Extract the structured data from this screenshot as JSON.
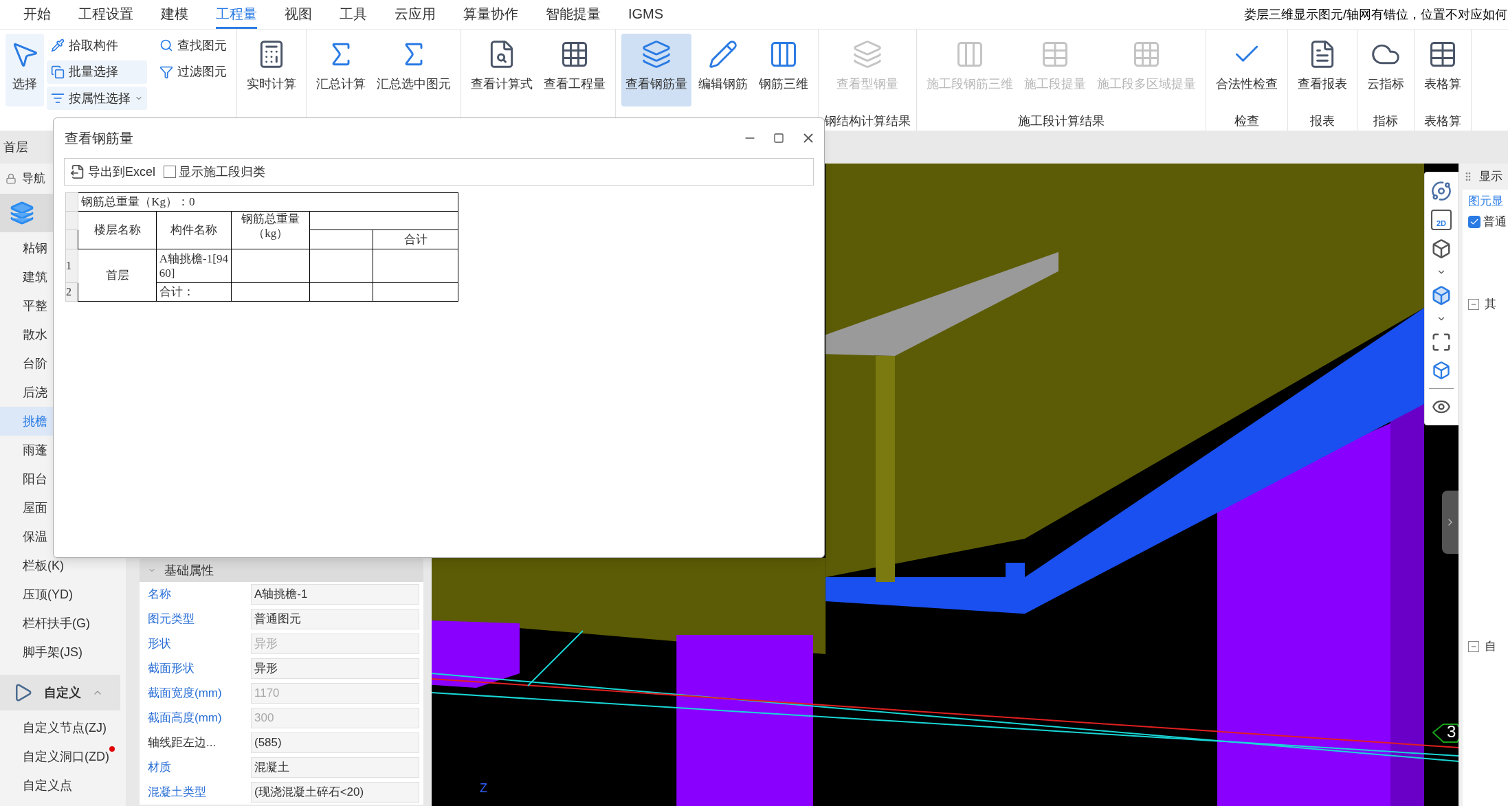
{
  "menu": [
    {
      "label": "开始",
      "selected": false
    },
    {
      "label": "工程设置",
      "selected": false
    },
    {
      "label": "建模",
      "selected": false
    },
    {
      "label": "工程量",
      "selected": true
    },
    {
      "label": "视图",
      "selected": false
    },
    {
      "label": "工具",
      "selected": false
    },
    {
      "label": "云应用",
      "selected": false
    },
    {
      "label": "算量协作",
      "selected": false
    },
    {
      "label": "智能提量",
      "selected": false
    },
    {
      "label": "IGMS",
      "selected": false
    }
  ],
  "help_search": "娄层三维显示图元/轴网有错位，位置不对应如何",
  "ribbon": [
    {
      "buttons": [
        {
          "label": "选择",
          "kind": "large",
          "selected": false,
          "highlighted": true,
          "disabled": false
        },
        {
          "label": "拾取构件",
          "kind": "small",
          "selected": false,
          "highlighted": false,
          "disabled": false
        },
        {
          "label": "批量选择",
          "kind": "small",
          "selected": false,
          "highlighted": true,
          "disabled": false
        },
        {
          "label": "按属性选择",
          "kind": "small",
          "selected": false,
          "highlighted": true,
          "disabled": false,
          "dropdown": true
        },
        {
          "label": "查找图元",
          "kind": "small",
          "selected": false,
          "highlighted": false,
          "disabled": false
        },
        {
          "label": "过滤图元",
          "kind": "small",
          "selected": false,
          "highlighted": false,
          "disabled": false
        }
      ]
    },
    {
      "buttons": [
        {
          "label": "实时计算",
          "kind": "large",
          "selected": false,
          "highlighted": false,
          "disabled": false
        }
      ]
    },
    {
      "buttons": [
        {
          "label": "汇总计算",
          "kind": "large",
          "selected": false,
          "highlighted": false,
          "disabled": false
        },
        {
          "label": "汇总选中图元",
          "kind": "large",
          "selected": false,
          "highlighted": false,
          "disabled": false
        }
      ]
    },
    {
      "buttons": [
        {
          "label": "查看计算式",
          "kind": "large",
          "selected": false,
          "highlighted": false,
          "disabled": false
        },
        {
          "label": "查看工程量",
          "kind": "large",
          "selected": false,
          "highlighted": false,
          "disabled": false
        }
      ]
    },
    {
      "buttons": [
        {
          "label": "查看钢筋量",
          "kind": "large",
          "selected": true,
          "highlighted": false,
          "disabled": false
        },
        {
          "label": "编辑钢筋",
          "kind": "large",
          "selected": false,
          "highlighted": false,
          "disabled": false
        },
        {
          "label": "钢筋三维",
          "kind": "large",
          "selected": false,
          "highlighted": false,
          "disabled": false
        }
      ]
    },
    {
      "label": "钢结构计算结果",
      "buttons": [
        {
          "label": "查看型钢量",
          "kind": "large",
          "selected": false,
          "highlighted": false,
          "disabled": true
        }
      ]
    },
    {
      "label": "施工段计算结果",
      "buttons": [
        {
          "label": "施工段钢筋三维",
          "kind": "large",
          "selected": false,
          "highlighted": false,
          "disabled": true
        },
        {
          "label": "施工段提量",
          "kind": "large",
          "selected": false,
          "highlighted": false,
          "disabled": true
        },
        {
          "label": "施工段多区域提量",
          "kind": "large",
          "selected": false,
          "highlighted": false,
          "disabled": true
        }
      ]
    },
    {
      "label": "检查",
      "buttons": [
        {
          "label": "合法性检查",
          "kind": "large",
          "selected": false,
          "highlighted": false,
          "disabled": false
        }
      ]
    },
    {
      "label": "报表",
      "buttons": [
        {
          "label": "查看报表",
          "kind": "large",
          "selected": false,
          "highlighted": false,
          "disabled": false
        }
      ]
    },
    {
      "label": "指标",
      "buttons": [
        {
          "label": "云指标",
          "kind": "large",
          "selected": false,
          "highlighted": false,
          "disabled": false
        }
      ]
    },
    {
      "label": "表格算",
      "buttons": [
        {
          "label": "表格算",
          "kind": "large",
          "selected": false,
          "highlighted": false,
          "disabled": false
        }
      ]
    }
  ],
  "floor": "首层",
  "left_nav": {
    "title": "导航",
    "items": [
      {
        "label": "粘钢",
        "selected": false
      },
      {
        "label": "建筑",
        "selected": false
      },
      {
        "label": "平整",
        "selected": false
      },
      {
        "label": "散水",
        "selected": false
      },
      {
        "label": "台阶",
        "selected": false
      },
      {
        "label": "后浇",
        "selected": false
      },
      {
        "label": "挑檐",
        "selected": true
      },
      {
        "label": "雨蓬",
        "selected": false
      },
      {
        "label": "阳台",
        "selected": false
      },
      {
        "label": "屋面",
        "selected": false
      },
      {
        "label": "保温",
        "selected": false
      },
      {
        "label": "栏板(K)",
        "selected": false
      },
      {
        "label": "压顶(YD)",
        "selected": false
      },
      {
        "label": "栏杆扶手(G)",
        "selected": false
      },
      {
        "label": "脚手架(JS)",
        "selected": false
      }
    ],
    "group": {
      "label": "自定义",
      "expanded": true,
      "items": [
        {
          "label": "自定义节点(ZJ)",
          "notification": false
        },
        {
          "label": "自定义洞口(ZD)",
          "notification": true
        },
        {
          "label": "自定义点",
          "notification": false
        }
      ]
    }
  },
  "properties": {
    "section": "基础属性",
    "rows": [
      {
        "label": "名称",
        "value": "A轴挑檐-1",
        "linked": true,
        "disabled": false
      },
      {
        "label": "图元类型",
        "value": "普通图元",
        "linked": true,
        "disabled": false
      },
      {
        "label": "形状",
        "value": "异形",
        "linked": true,
        "disabled": true
      },
      {
        "label": "截面形状",
        "value": "异形",
        "linked": true,
        "disabled": false
      },
      {
        "label": "截面宽度(mm)",
        "value": "1170",
        "linked": true,
        "disabled": true
      },
      {
        "label": "截面高度(mm)",
        "value": "300",
        "linked": true,
        "disabled": true
      },
      {
        "label": "轴线距左边...",
        "value": "(585)",
        "linked": false,
        "disabled": false
      },
      {
        "label": "材质",
        "value": "混凝土",
        "linked": true,
        "disabled": false
      },
      {
        "label": "混凝土类型",
        "value": "(现浇混凝土碎石<20)",
        "linked": true,
        "disabled": false
      }
    ]
  },
  "dialog": {
    "title": "查看钢筋量",
    "export": "导出到Excel",
    "checkbox": {
      "label": "显示施工段归类",
      "checked": false
    },
    "table": {
      "total": "钢筋总重量（Kg）：0",
      "columns": [
        "楼层名称",
        "构件名称",
        "钢筋总重量（kg）"
      ],
      "sub_column": "合计",
      "row_numbers": [
        "1",
        "2"
      ],
      "floor": "首层",
      "component": "A轴挑檐-1[9460]",
      "subtotal": "合计："
    }
  },
  "viewport": {
    "grid_label": "3",
    "axis_label": "Z",
    "view_tools_2d": "2D"
  },
  "right_panel": {
    "title": "显示",
    "tab": "图元显",
    "checkbox": {
      "label": "普通",
      "checked": true
    },
    "tree": [
      {
        "label": "其",
        "expanded": true
      },
      {
        "label": "自",
        "expanded": true
      }
    ]
  }
}
